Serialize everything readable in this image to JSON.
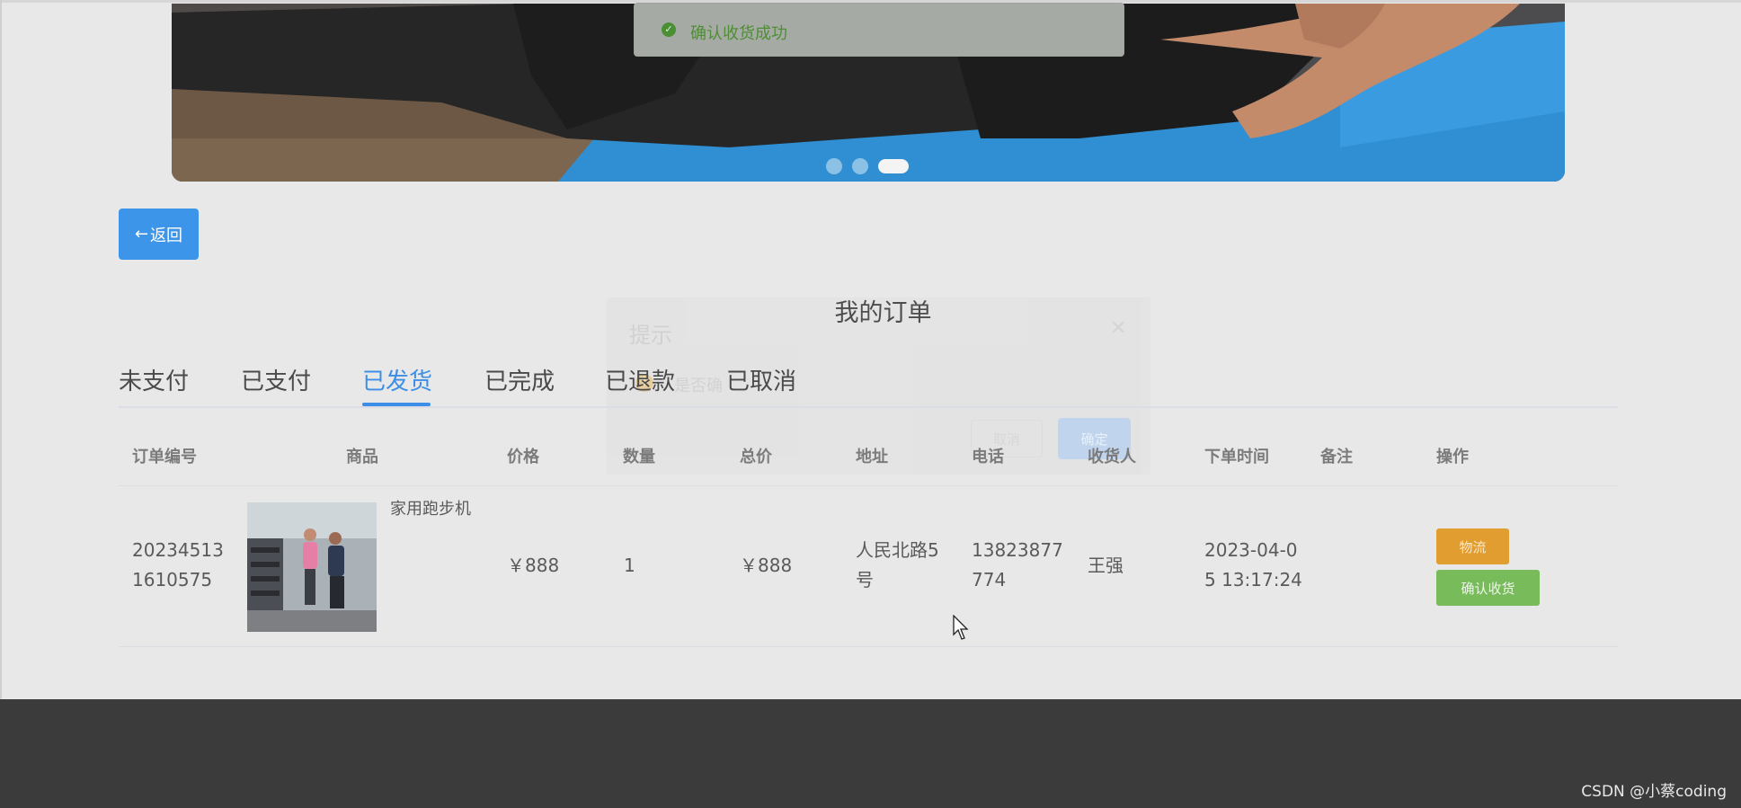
{
  "toast": {
    "message": "确认收货成功",
    "icon": "check-circle-icon"
  },
  "back_button": {
    "label": "返回",
    "icon": "arrow-left-icon"
  },
  "dialog": {
    "title": "提示",
    "message": "是否确",
    "cancel": "取消",
    "confirm": "确定",
    "icons": [
      "warning-icon",
      "close-icon"
    ]
  },
  "page_title": "我的订单",
  "tabs": [
    "未支付",
    "已支付",
    "已发货",
    "已完成",
    "已退款",
    "已取消"
  ],
  "active_tab": "已发货",
  "table": {
    "headers": [
      "订单编号",
      "商品",
      "价格",
      "数量",
      "总价",
      "地址",
      "电话",
      "收货人",
      "下单时间",
      "备注",
      "操作"
    ],
    "rows": [
      {
        "order_no_line1": "20234513",
        "order_no_line2": "1610575",
        "product_name": "家用跑步机",
        "price": "￥888",
        "quantity": "1",
        "total": "￥888",
        "address_line1": "人民北路5",
        "address_line2": "号",
        "phone_line1": "13823877",
        "phone_line2": "774",
        "receiver": "王强",
        "time_line1": "2023-04-0",
        "time_line2": "5 13:17:24",
        "note": "",
        "actions": {
          "logistics": "物流",
          "confirm_receipt": "确认收货"
        }
      }
    ]
  },
  "carousel": {
    "slides": 3,
    "active_slide": 3
  },
  "watermark": "CSDN @小蔡coding",
  "colors": {
    "primary": "#3d95ea",
    "success": "#77bb5b",
    "warning": "#e19d30",
    "footer": "#3b3b3b"
  }
}
